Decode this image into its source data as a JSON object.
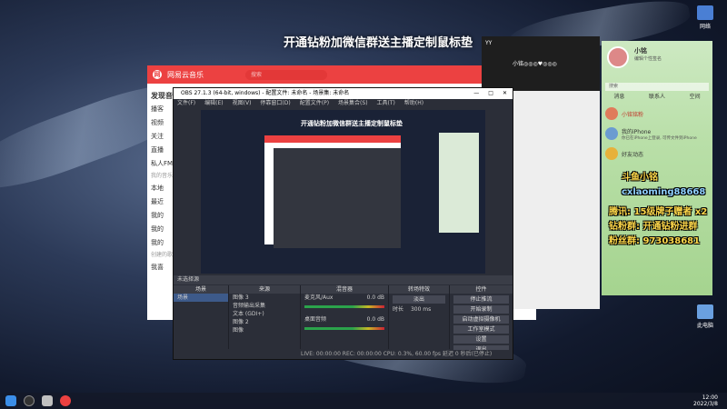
{
  "desktop": {
    "banner": "开通钻粉加微信群送主播定制鼠标垫",
    "icons": [
      {
        "label": "网络",
        "color": "#4a7fd4"
      },
      {
        "label": "此电脑",
        "color": "#6aa0e0"
      }
    ]
  },
  "music_app": {
    "title": "网易云音乐",
    "search_placeholder": "搜索",
    "sidebar": {
      "header": "发现音乐",
      "items": [
        "播客",
        "视频",
        "关注",
        "直播",
        "私人FM"
      ],
      "group_label": "我的音乐",
      "my_items": [
        "本地",
        "最近",
        "我的",
        "我的",
        "我的"
      ],
      "playlist_label": "创建的歌单",
      "playlist_item": "我喜"
    }
  },
  "obs": {
    "title": "OBS 27.1.3 (64-bit, windows) - 配置文件: 未命名 - 场景集: 未命名",
    "menu": [
      "文件(F)",
      "编辑(E)",
      "视图(V)",
      "停靠窗口(D)",
      "配置文件(P)",
      "场景集合(S)",
      "工具(T)",
      "帮助(H)"
    ],
    "preview_banner": "开通钻粉加微信群送主播定制鼠标垫",
    "source_bar": "未选择源",
    "docks": {
      "scenes": {
        "title": "场景",
        "items": [
          "场景"
        ]
      },
      "sources": {
        "title": "来源",
        "items": [
          "图像 3",
          "音频输出采集",
          "文本 (GDI+)",
          "图像 2",
          "图像"
        ]
      },
      "mixer": {
        "title": "混音器",
        "channels": [
          {
            "name": "麦克风/Aux",
            "db": "0.0 dB"
          },
          {
            "name": "桌面音频",
            "db": "0.0 dB"
          }
        ]
      },
      "transitions": {
        "title": "转场特效",
        "mode": "淡出",
        "duration_label": "时长",
        "duration": "300 ms"
      },
      "controls": {
        "title": "控件",
        "buttons": [
          "停止推流",
          "开始录制",
          "启动虚拟摄像机",
          "工作室模式",
          "设置",
          "退出"
        ]
      }
    },
    "status": "LIVE: 00:00:00    REC: 00:00:00    CPU: 0.3%, 60.00 fps    延迟     0 秒后(已停止)"
  },
  "yy_app": {
    "title": "YY",
    "user": "小铭◎◎◎♥◎◎◎"
  },
  "qq_app": {
    "name": "小铭",
    "status": "编辑个性签名",
    "search_placeholder": "搜索",
    "tabs": [
      "消息",
      "联系人",
      "空间"
    ],
    "items": [
      {
        "name": "小铭铭粉",
        "msg": ""
      },
      {
        "name": "我的iPhone",
        "msg": "你已在iPhone上登录, 可传文件到iPhone"
      },
      {
        "name": "好友动态",
        "msg": ""
      }
    ]
  },
  "chat_overlay": [
    {
      "text": "斗鱼小铭",
      "color": "#ffd84a"
    },
    {
      "text": "cxlaoming88668",
      "color": "#8fd0ff"
    },
    {
      "text": "腾讯: 15级牌子赠者  x2",
      "color": "#ffd84a"
    },
    {
      "text": "钻粉群: 开通钻粉进群",
      "color": "#ffd84a"
    },
    {
      "text": "粉丝群: 973038681",
      "color": "#ffd84a"
    }
  ],
  "taskbar": {
    "time": "12:00",
    "date": "2022/3/8"
  }
}
